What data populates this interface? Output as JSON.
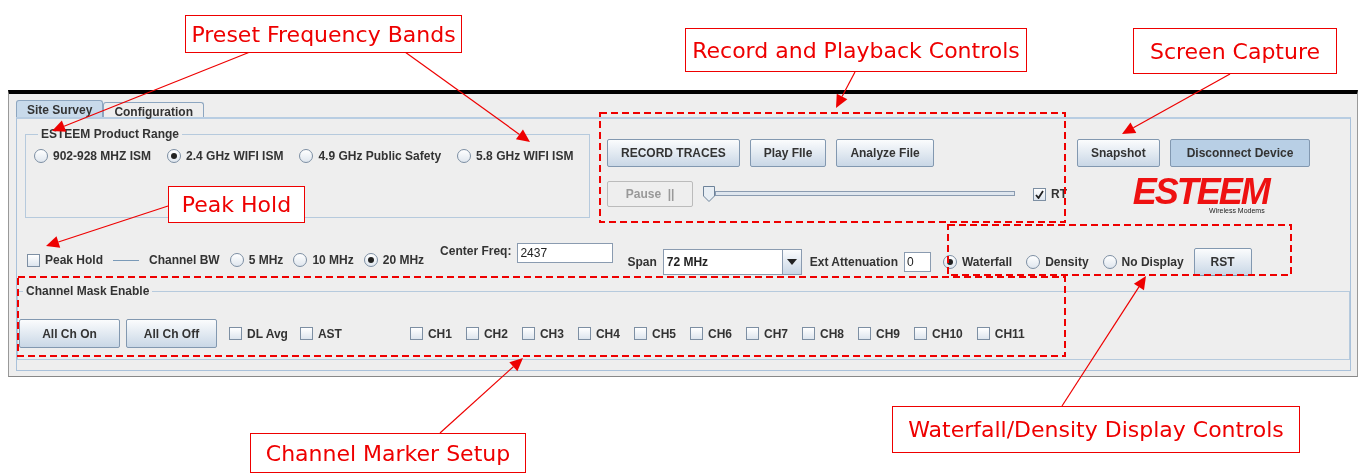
{
  "annotations": [
    {
      "text": "Preset Frequency Bands"
    },
    {
      "text": "Record and Playback Controls"
    },
    {
      "text": "Screen Capture"
    },
    {
      "text": "Peak Hold"
    },
    {
      "text": "Waterfall/Density Display Controls"
    },
    {
      "text": "Channel Marker Setup"
    }
  ],
  "tabs": [
    {
      "label": "Site Survey",
      "selected": true
    },
    {
      "label": "Configuration",
      "selected": false
    }
  ],
  "product_range": {
    "title": "ESTEEM Product Range",
    "options": [
      {
        "label": "902-928 MHZ ISM",
        "selected": false
      },
      {
        "label": "2.4 GHz WIFI ISM",
        "selected": true
      },
      {
        "label": "4.9 GHz Public Safety",
        "selected": false
      },
      {
        "label": "5.8 GHz WIFI ISM",
        "selected": false
      }
    ]
  },
  "record": {
    "buttons": [
      "RECORD TRACES",
      "Play FIle",
      "Analyze File"
    ],
    "pause": {
      "label": "Pause  ||",
      "disabled": true
    },
    "slider": {
      "level": 0
    },
    "rt": {
      "label": "RT",
      "checked": true
    }
  },
  "capture": {
    "buttons": [
      {
        "label": "Snapshot",
        "selected": false
      },
      {
        "label": "Disconnect Device",
        "selected": true
      }
    ]
  },
  "logo": {
    "name": "ESTEEM",
    "tagline": "Wireless Modems"
  },
  "settings": {
    "peak_hold": {
      "label": "Peak Hold",
      "checked": false
    },
    "channel_bw": {
      "label": "Channel BW",
      "options": [
        {
          "label": "5 MHz",
          "selected": false
        },
        {
          "label": "10 MHz",
          "selected": false
        },
        {
          "label": "20 MHz",
          "selected": true
        }
      ]
    },
    "center_freq": {
      "label": "Center Freq:",
      "value": "2437"
    },
    "span": {
      "label": "Span",
      "value": "72 MHz"
    },
    "ext_attenuation": {
      "label": "Ext Attenuation",
      "value": "0"
    },
    "display_mode": [
      {
        "label": "Waterfall",
        "selected": true
      },
      {
        "label": "Density",
        "selected": false
      },
      {
        "label": "No Display",
        "selected": false
      }
    ],
    "reset": "RST"
  },
  "channel_mask": {
    "title": "Channel Mask Enable",
    "buttons": [
      "All Ch On",
      "All Ch Off"
    ],
    "options": [
      {
        "label": "DL Avg",
        "checked": false
      },
      {
        "label": "AST",
        "checked": false
      }
    ],
    "channels": [
      {
        "label": "CH1",
        "checked": false
      },
      {
        "label": "CH2",
        "checked": false
      },
      {
        "label": "CH3",
        "checked": false
      },
      {
        "label": "CH4",
        "checked": false
      },
      {
        "label": "CH5",
        "checked": false
      },
      {
        "label": "CH6",
        "checked": false
      },
      {
        "label": "CH7",
        "checked": false
      },
      {
        "label": "CH8",
        "checked": false
      },
      {
        "label": "CH9",
        "checked": false
      },
      {
        "label": "CH10",
        "checked": false
      },
      {
        "label": "CH11",
        "checked": false
      }
    ]
  }
}
